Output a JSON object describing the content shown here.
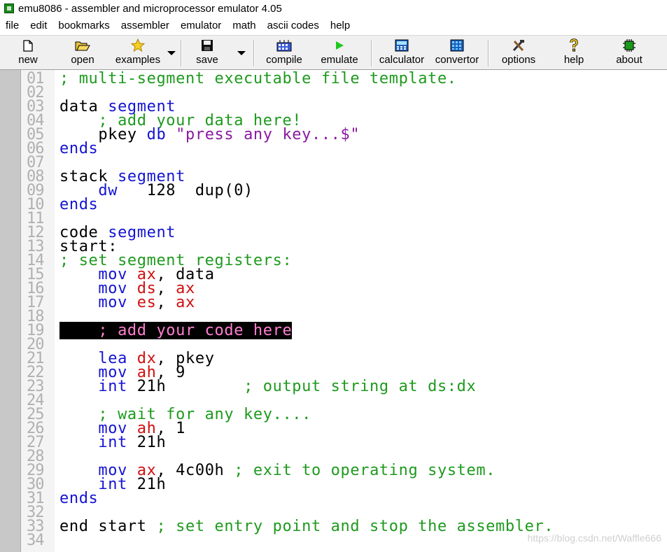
{
  "window": {
    "title": "emu8086 - assembler and microprocessor emulator 4.05",
    "icon": "chip-icon"
  },
  "menu": [
    "file",
    "edit",
    "bookmarks",
    "assembler",
    "emulator",
    "math",
    "ascii codes",
    "help"
  ],
  "toolbar": {
    "new": "new",
    "open": "open",
    "examples": "examples",
    "save": "save",
    "compile": "compile",
    "emulate": "emulate",
    "calculator": "calculator",
    "convertor": "convertor",
    "options": "options",
    "help": "help",
    "about": "about"
  },
  "editor": {
    "lines": [
      {
        "n": "01",
        "code": [
          [
            "c-comment",
            "; multi-segment executable file template."
          ]
        ]
      },
      {
        "n": "02",
        "code": []
      },
      {
        "n": "03",
        "code": [
          [
            "c-id",
            "data "
          ],
          [
            "c-kw",
            "segment"
          ]
        ]
      },
      {
        "n": "04",
        "code": [
          [
            "c-comment",
            "    ; add your data here!"
          ]
        ]
      },
      {
        "n": "05",
        "code": [
          [
            "c-id",
            "    pkey "
          ],
          [
            "c-kw",
            "db "
          ],
          [
            "c-str",
            "\"press any key...$\""
          ]
        ]
      },
      {
        "n": "06",
        "code": [
          [
            "c-kw",
            "ends"
          ]
        ]
      },
      {
        "n": "07",
        "code": []
      },
      {
        "n": "08",
        "code": [
          [
            "c-id",
            "stack "
          ],
          [
            "c-kw",
            "segment"
          ]
        ]
      },
      {
        "n": "09",
        "code": [
          [
            "c-kw",
            "    dw   "
          ],
          [
            "c-id",
            "128  dup(0)"
          ]
        ]
      },
      {
        "n": "10",
        "code": [
          [
            "c-kw",
            "ends"
          ]
        ]
      },
      {
        "n": "11",
        "code": []
      },
      {
        "n": "12",
        "code": [
          [
            "c-id",
            "code "
          ],
          [
            "c-kw",
            "segment"
          ]
        ]
      },
      {
        "n": "13",
        "code": [
          [
            "c-id",
            "start:"
          ]
        ]
      },
      {
        "n": "14",
        "code": [
          [
            "c-comment",
            "; set segment registers:"
          ]
        ]
      },
      {
        "n": "15",
        "code": [
          [
            "c-kw",
            "    mov "
          ],
          [
            "c-reg",
            "ax"
          ],
          [
            "c-id",
            ", data"
          ]
        ]
      },
      {
        "n": "16",
        "code": [
          [
            "c-kw",
            "    mov "
          ],
          [
            "c-reg",
            "ds"
          ],
          [
            "c-id",
            ", "
          ],
          [
            "c-reg",
            "ax"
          ]
        ]
      },
      {
        "n": "17",
        "code": [
          [
            "c-kw",
            "    mov "
          ],
          [
            "c-reg",
            "es"
          ],
          [
            "c-id",
            ", "
          ],
          [
            "c-reg",
            "ax"
          ]
        ]
      },
      {
        "n": "18",
        "code": []
      },
      {
        "n": "19",
        "code": [
          [
            "highlight",
            "    ; add your code here"
          ]
        ]
      },
      {
        "n": "20",
        "code": []
      },
      {
        "n": "21",
        "code": [
          [
            "c-kw",
            "    lea "
          ],
          [
            "c-reg",
            "dx"
          ],
          [
            "c-id",
            ", pkey"
          ]
        ]
      },
      {
        "n": "22",
        "code": [
          [
            "c-kw",
            "    mov "
          ],
          [
            "c-reg",
            "ah"
          ],
          [
            "c-id",
            ", 9"
          ]
        ]
      },
      {
        "n": "23",
        "code": [
          [
            "c-kw",
            "    int "
          ],
          [
            "c-id",
            "21h        "
          ],
          [
            "c-comment",
            "; output string at ds:dx"
          ]
        ]
      },
      {
        "n": "24",
        "code": []
      },
      {
        "n": "25",
        "code": [
          [
            "c-comment",
            "    ; wait for any key...."
          ]
        ]
      },
      {
        "n": "26",
        "code": [
          [
            "c-kw",
            "    mov "
          ],
          [
            "c-reg",
            "ah"
          ],
          [
            "c-id",
            ", 1"
          ]
        ]
      },
      {
        "n": "27",
        "code": [
          [
            "c-kw",
            "    int "
          ],
          [
            "c-id",
            "21h"
          ]
        ]
      },
      {
        "n": "28",
        "code": []
      },
      {
        "n": "29",
        "code": [
          [
            "c-kw",
            "    mov "
          ],
          [
            "c-reg",
            "ax"
          ],
          [
            "c-id",
            ", 4c00h "
          ],
          [
            "c-comment",
            "; exit to operating system."
          ]
        ]
      },
      {
        "n": "30",
        "code": [
          [
            "c-kw",
            "    int "
          ],
          [
            "c-id",
            "21h"
          ]
        ]
      },
      {
        "n": "31",
        "code": [
          [
            "c-kw",
            "ends"
          ]
        ]
      },
      {
        "n": "32",
        "code": []
      },
      {
        "n": "33",
        "code": [
          [
            "c-id",
            "end start "
          ],
          [
            "c-comment",
            "; set entry point and stop the assembler."
          ]
        ]
      },
      {
        "n": "34",
        "code": []
      }
    ]
  },
  "watermark": "https://blog.csdn.net/Waffle666"
}
